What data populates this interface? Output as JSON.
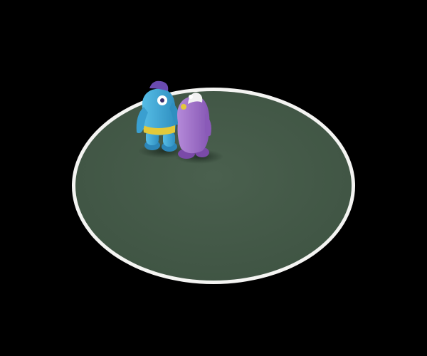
{
  "scene": {
    "background_color": "#000000",
    "mat": {
      "fill_color": "#435847",
      "rim_color": "#f4f4f2"
    },
    "figures": [
      {
        "name": "blue-clay-monster",
        "body_color": "#3aa6d6",
        "accent_color": "#e3c93a",
        "head_color": "#6a4bb0"
      },
      {
        "name": "purple-clay-monster",
        "body_color": "#9a6cc6",
        "accent_color": "#8a5ab8",
        "horn_color": "#f2f2f2"
      }
    ]
  }
}
